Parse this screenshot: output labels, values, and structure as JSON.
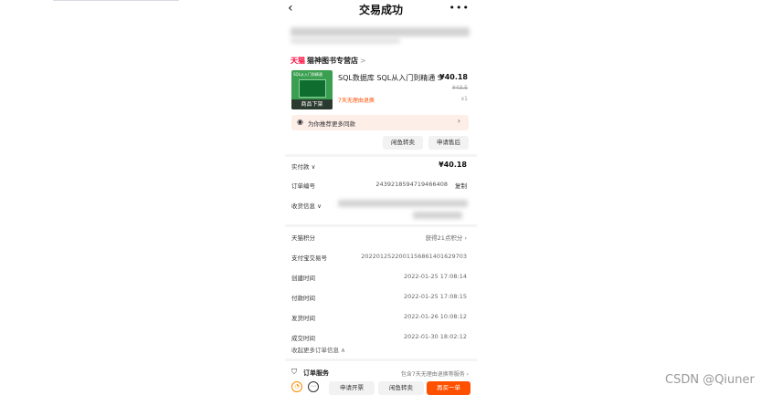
{
  "nav": {
    "back_icon": "back-arrow-icon",
    "title": "交易成功",
    "more_icon": "more-dots-icon"
  },
  "store": {
    "brand": "天猫",
    "name": "猫神图书专营店",
    "chevron": ">"
  },
  "product": {
    "thumb_text": "SQL从入门到精通",
    "badge": "商品下架",
    "title": "SQL数据库 SQL从入门到精通 S",
    "price": "¥40.18",
    "original_price": "¥43.5",
    "return_policy": "7天无理由退换",
    "quantity": "x1"
  },
  "recommend": {
    "icon": "camera-icon",
    "text": "为你推荐更多同款",
    "chevron": "›"
  },
  "product_actions": {
    "sell_label": "闲鱼转卖",
    "after_sale_label": "申请售后"
  },
  "payment": {
    "label": "实付款 ∨",
    "amount": "¥40.18"
  },
  "order": {
    "label": "订单编号",
    "value": "2439218594719466408",
    "copy_label": "复制"
  },
  "address": {
    "label": "收货信息 ∨"
  },
  "details": [
    {
      "label": "天猫积分",
      "value": "获得21点积分 ›"
    },
    {
      "label": "支付宝交易号",
      "value": "2022012522001156861401629703"
    },
    {
      "label": "创建时间",
      "value": "2022-01-25 17:08:14"
    },
    {
      "label": "付款时间",
      "value": "2022-01-25 17:08:15"
    },
    {
      "label": "发货时间",
      "value": "2022-01-26 10:08:12"
    },
    {
      "label": "成交时间",
      "value": "2022-01-30 18:02:12"
    }
  ],
  "collapse_label": "收起更多订单信息 ∧",
  "service": {
    "label": "订单服务",
    "value": "包含7天无理由退换等服务 ›"
  },
  "bottom_bar": {
    "icon_a": "orange-circle-icon",
    "icon_b": "chat-icon",
    "invoice_label": "申请开票",
    "resell_label": "闲鱼转卖",
    "buy_again_label": "再买一单"
  },
  "watermark": "CSDN @Qiuner",
  "colors": {
    "accent": "#ff5000",
    "brand_red": "#ff0036",
    "tint_bg": "#fdeee8"
  }
}
